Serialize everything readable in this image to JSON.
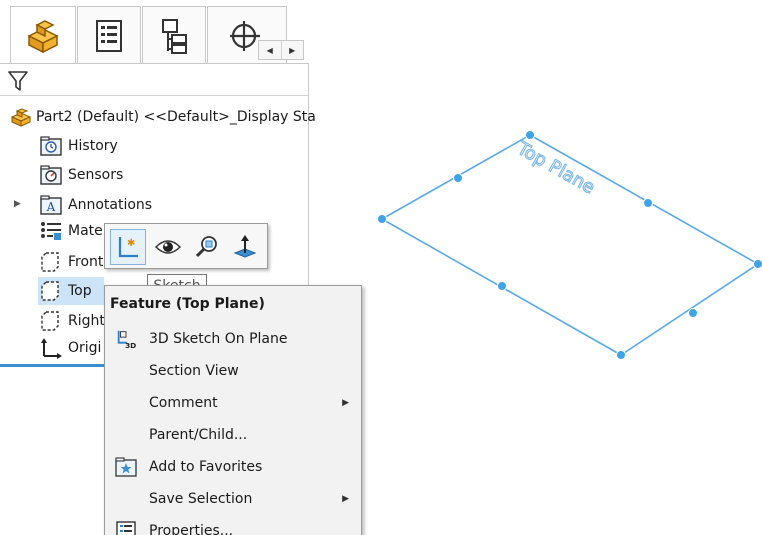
{
  "tree": {
    "root_label": "Part2 (Default) <<Default>_Display Sta",
    "items": [
      {
        "label": "History",
        "icon": "history-icon"
      },
      {
        "label": "Sensors",
        "icon": "sensors-icon"
      },
      {
        "label": "Annotations",
        "icon": "annotations-icon"
      },
      {
        "label": "Mate",
        "icon": "material-icon"
      },
      {
        "label": "Front",
        "icon": "plane-icon"
      },
      {
        "label": "Top",
        "icon": "plane-icon"
      },
      {
        "label": "Right",
        "icon": "plane-icon"
      },
      {
        "label": "Origi",
        "icon": "origin-icon"
      }
    ]
  },
  "context_toolbar": {
    "buttons": [
      "sketch",
      "show-hide",
      "normal-to",
      "offset-plane"
    ],
    "tooltip": "Sketch"
  },
  "context_menu": {
    "header": "Feature (Top Plane)",
    "items": [
      {
        "label": "3D Sketch On Plane",
        "icon": "3d-sketch-icon",
        "submenu": false
      },
      {
        "label": "Section View",
        "icon": "",
        "submenu": false
      },
      {
        "label": "Comment",
        "icon": "",
        "submenu": true
      },
      {
        "label": "Parent/Child...",
        "icon": "",
        "submenu": false
      },
      {
        "label": "Add to Favorites",
        "icon": "favorites-icon",
        "submenu": false
      },
      {
        "label": "Save Selection",
        "icon": "",
        "submenu": true
      },
      {
        "label": "Properties...",
        "icon": "properties-icon",
        "submenu": false
      }
    ]
  },
  "viewport": {
    "plane_label": "Top Plane",
    "plane_color": "#5aa9e6",
    "handle_color": "#3fa3e8"
  },
  "colors": {
    "selection": "#cce4f7",
    "accent": "#3b8fd0"
  }
}
